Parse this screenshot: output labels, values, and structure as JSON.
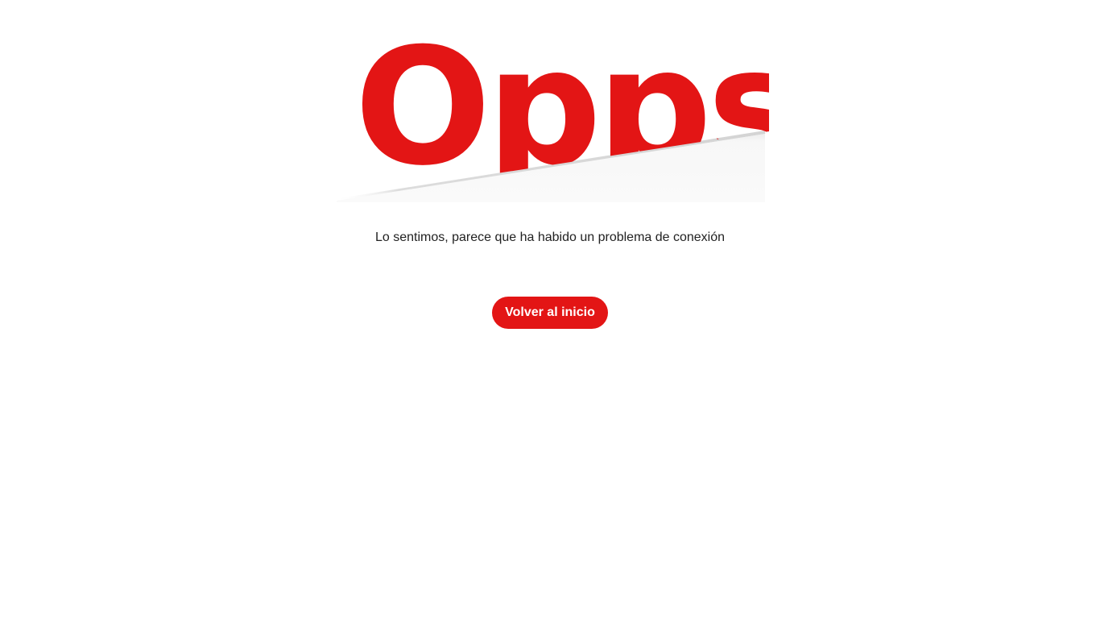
{
  "hero": {
    "word": "Opps",
    "color": "#e31515",
    "paper_color": "#f8f8f8"
  },
  "message": "Lo sentimos, parece que ha habido un problema de conexión",
  "home_button": {
    "label": "Volver al inicio",
    "color": "#e31515"
  }
}
